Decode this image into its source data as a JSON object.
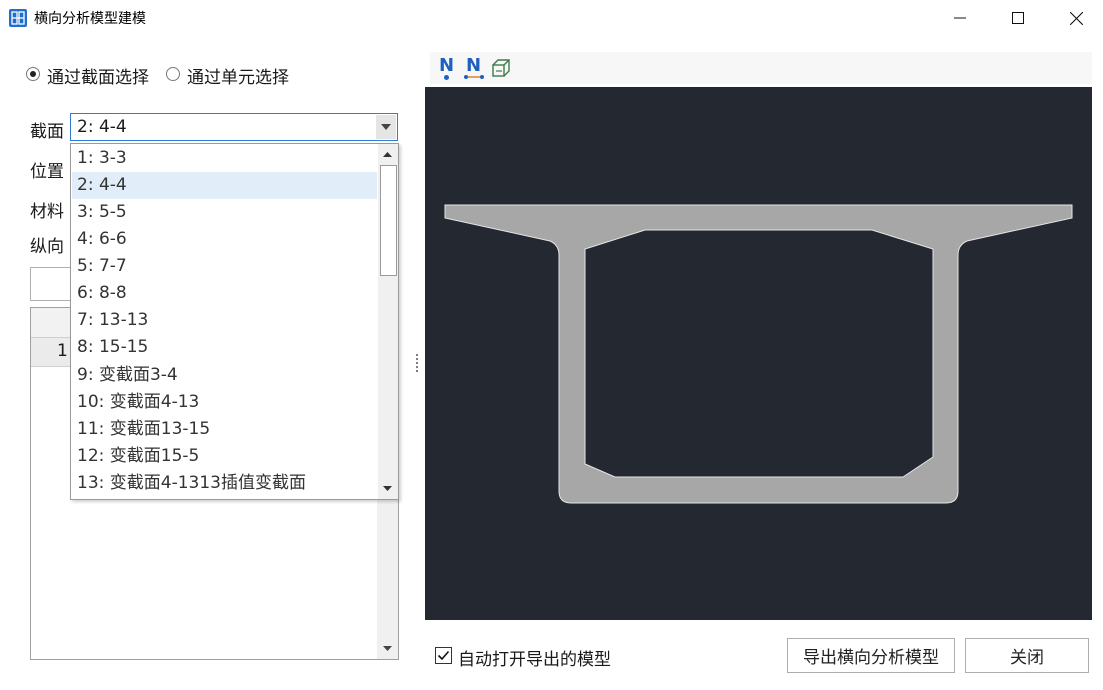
{
  "window": {
    "title": "横向分析模型建模",
    "icon": "app-grid-icon",
    "controls": [
      "minimize-icon",
      "maximize-icon",
      "close-icon"
    ]
  },
  "selection_mode": {
    "by_section_label": "通过截面选择",
    "by_element_label": "通过单元选择",
    "selected": "by_section"
  },
  "form": {
    "section_label": "截面",
    "position_label": "位置",
    "material_label": "材料",
    "longitudinal_label": "纵向"
  },
  "section_combo": {
    "value": "2: 4-4",
    "options": [
      "1: 3-3",
      "2: 4-4",
      "3: 5-5",
      "4: 6-6",
      "5: 7-7",
      "6: 8-8",
      "7: 13-13",
      "8: 15-15",
      "9: 变截面3-4",
      "10: 变截面4-13",
      "11: 变截面13-15",
      "12: 变截面15-5",
      "13: 变截面4-1313插值变截面"
    ],
    "selected_index": 1
  },
  "table": {
    "row_number": "1"
  },
  "toolbar": {
    "tools": [
      "node-number-icon",
      "element-number-icon",
      "3d-view-icon"
    ],
    "node_glyph": "N",
    "element_glyph": "N"
  },
  "preview": {
    "background": "#232831",
    "section_fill": "#a7a7a7",
    "section_stroke": "#e6e6e6"
  },
  "bottom": {
    "auto_open_label": "自动打开导出的模型",
    "auto_open_checked": true,
    "export_button": "导出横向分析模型",
    "close_button": "关闭"
  }
}
